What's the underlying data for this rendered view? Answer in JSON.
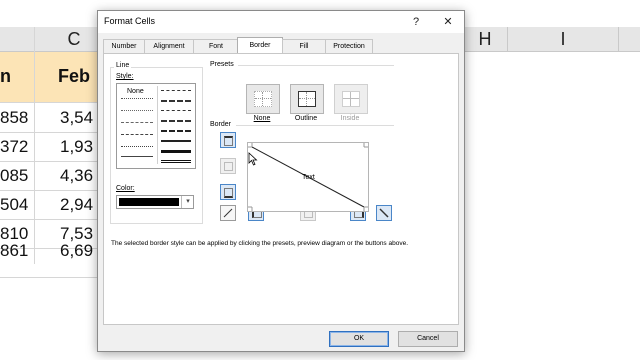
{
  "sheet": {
    "columns": [
      "C",
      "H",
      "I"
    ],
    "header_cells": [
      "n",
      "Feb"
    ],
    "rows": [
      [
        "858",
        "3,54"
      ],
      [
        "372",
        "1,93"
      ],
      [
        "085",
        "4,36"
      ],
      [
        "504",
        "2,94"
      ],
      [
        "810",
        "7,53"
      ],
      [
        "861",
        "6,69"
      ]
    ]
  },
  "dialog": {
    "title": "Format Cells",
    "help": "?",
    "close": "✕",
    "tabs": [
      "Number",
      "Alignment",
      "Font",
      "Border",
      "Fill",
      "Protection"
    ],
    "active_tab": "Border",
    "line_label": "Line",
    "style_label": "Style:",
    "style_none": "None",
    "color_label": "Color:",
    "color_value": "#000000",
    "presets_label": "Presets",
    "presets": [
      "None",
      "Outline",
      "Inside"
    ],
    "border_label": "Border",
    "preview_text": "Text",
    "description": "The selected border style can be applied by clicking the presets, preview diagram or the buttons above.",
    "ok": "OK",
    "cancel": "Cancel"
  },
  "colors": {
    "header_fill": "#fce4b6",
    "accent": "#2f70c0"
  }
}
